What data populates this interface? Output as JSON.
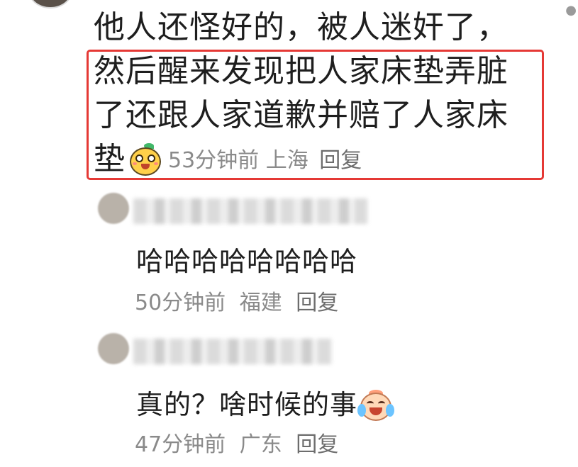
{
  "main_comment": {
    "line1": "他人还怪好的，被人迷奸了，",
    "line2": "然后醒来发现把人家床垫弄脏",
    "line3": "了还跟人家道歉并赔了人家床",
    "line4": "垫",
    "emoji": "duck-emoji",
    "time": "53分钟前",
    "location": "上海",
    "reply_label": "回复"
  },
  "replies": [
    {
      "content": "哈哈哈哈哈哈哈哈",
      "time": "50分钟前",
      "location": "福建",
      "reply_label": "回复"
    },
    {
      "content": "真的？啥时候的事",
      "emoji": "laughing-crying-emoji",
      "time": "47分钟前",
      "location": "广东",
      "reply_label": "回复"
    }
  ],
  "colors": {
    "highlight_border": "#e53935",
    "meta_text": "#8a8a8a",
    "body_text": "#1e1e1e"
  }
}
